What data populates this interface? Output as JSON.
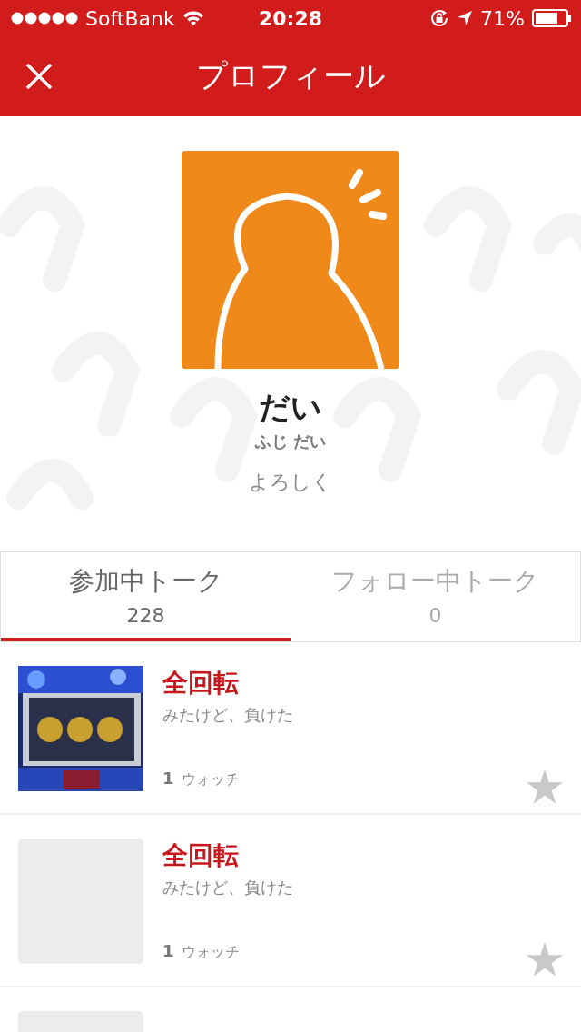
{
  "status_bar": {
    "carrier": "SoftBank",
    "time": "20:28",
    "battery": "71%"
  },
  "nav": {
    "title": "プロフィール"
  },
  "profile": {
    "name": "だい",
    "reading": "ふじ だい",
    "message": "よろしく"
  },
  "tabs": [
    {
      "label": "参加中トーク",
      "count": "228",
      "selected": true
    },
    {
      "label": "フォロー中トーク",
      "count": "0",
      "selected": false
    }
  ],
  "talks": [
    {
      "kind": "picture",
      "title": "全回転",
      "subtitle": "みたけど、負けた",
      "watch_count": "1",
      "watch_label": "ウォッチ"
    },
    {
      "kind": "empty",
      "title": "全回転",
      "subtitle": "みたけど、負けた",
      "watch_count": "1",
      "watch_label": "ウォッチ"
    },
    {
      "kind": "empty"
    }
  ]
}
